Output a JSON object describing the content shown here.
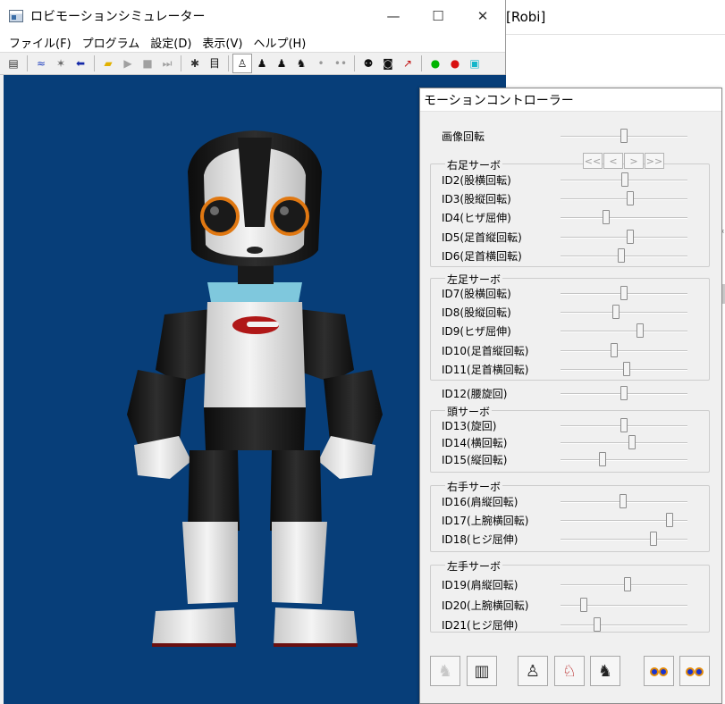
{
  "background_app": {
    "title": "[Robi]",
    "mark": "*"
  },
  "window": {
    "title": "ロビモーションシミュレーター",
    "controls": {
      "minimize": "—",
      "maximize": "☐",
      "close": "✕"
    }
  },
  "menu": [
    "ファイル(F)",
    "プログラム",
    "設定(D)",
    "表示(V)",
    "ヘルプ(H)"
  ],
  "toolbar": {
    "buttons": [
      {
        "icon": "list-icon",
        "glyph": "▤",
        "color": "#333333"
      },
      {
        "icon": "wave-icon",
        "glyph": "≈",
        "color": "#1f3fbf"
      },
      {
        "icon": "dance-icon",
        "glyph": "✶",
        "color": "#666666"
      },
      {
        "icon": "back-arrow-icon",
        "glyph": "⬅",
        "color": "#1428a8"
      },
      {
        "icon": "folder-open-icon",
        "glyph": "▰",
        "color": "#e2b100"
      },
      {
        "icon": "play-icon",
        "glyph": "▶",
        "color": "#a0a0a0"
      },
      {
        "icon": "stop-icon",
        "glyph": "■",
        "color": "#a0a0a0"
      },
      {
        "icon": "step-icon",
        "glyph": "⏭",
        "color": "#a0a0a0"
      },
      {
        "icon": "bug-icon",
        "glyph": "✱",
        "color": "#333333"
      },
      {
        "icon": "frame-icon",
        "glyph": "目",
        "color": "#111111"
      },
      {
        "icon": "robot-front-icon",
        "glyph": "♙",
        "color": "#111111"
      },
      {
        "icon": "robot-arm-up-icon",
        "glyph": "♟",
        "color": "#111111"
      },
      {
        "icon": "robot-stand-icon",
        "glyph": "♟",
        "color": "#111111"
      },
      {
        "icon": "robot-sit-icon",
        "glyph": "♞",
        "color": "#111111"
      },
      {
        "icon": "eye-single-icon",
        "glyph": "•",
        "color": "#999999"
      },
      {
        "icon": "eyes-double-icon",
        "glyph": "••",
        "color": "#999999"
      },
      {
        "icon": "robots-pair-icon",
        "glyph": "⚉",
        "color": "#111111"
      },
      {
        "icon": "camera-icon",
        "glyph": "◙",
        "color": "#111111"
      },
      {
        "icon": "robot-walk-icon",
        "glyph": "↗",
        "color": "#c01010"
      },
      {
        "icon": "green-light-icon",
        "glyph": "●",
        "color": "#00b400"
      },
      {
        "icon": "red-light-icon",
        "glyph": "●",
        "color": "#d81010"
      },
      {
        "icon": "robot-teal-icon",
        "glyph": "▣",
        "color": "#13b6c9"
      }
    ]
  },
  "colors": {
    "viewport_bg": "#073e79",
    "robot_black": "#1a1a1a",
    "robot_white": "#e8e8e8",
    "eye_ring": "#e07812",
    "collar": "#7fc8dd",
    "logo_red": "#b01818"
  },
  "controller": {
    "title": "モーションコントローラー",
    "image_rotation": {
      "label": "画像回転",
      "value": 0.5
    },
    "nav_buttons": [
      "<<",
      "<",
      ">",
      ">>"
    ],
    "right_leg": {
      "title": "右足サーボ",
      "servos": [
        {
          "label": "ID2(股横回転)",
          "value": 0.51
        },
        {
          "label": "ID3(股縦回転)",
          "value": 0.55
        },
        {
          "label": "ID4(ヒザ屈伸)",
          "value": 0.36
        },
        {
          "label": "ID5(足首縦回転)",
          "value": 0.55
        },
        {
          "label": "ID6(足首横回転)",
          "value": 0.48
        }
      ]
    },
    "left_leg": {
      "title": "左足サーボ",
      "servos": [
        {
          "label": "ID7(股横回転)",
          "value": 0.5
        },
        {
          "label": "ID8(股縦回転)",
          "value": 0.44
        },
        {
          "label": "ID9(ヒザ屈伸)",
          "value": 0.63
        },
        {
          "label": "ID10(足首縦回転)",
          "value": 0.42
        },
        {
          "label": "ID11(足首横回転)",
          "value": 0.52
        }
      ]
    },
    "waist": {
      "label": "ID12(腰旋回)",
      "value": 0.5
    },
    "head": {
      "title": "頭サーボ",
      "servos": [
        {
          "label": "ID13(旋回)",
          "value": 0.5
        },
        {
          "label": "ID14(横回転)",
          "value": 0.56
        },
        {
          "label": "ID15(縦回転)",
          "value": 0.33
        }
      ]
    },
    "right_arm": {
      "title": "右手サーボ",
      "servos": [
        {
          "label": "ID16(肩縦回転)",
          "value": 0.49
        },
        {
          "label": "ID17(上腕横回転)",
          "value": 0.86
        },
        {
          "label": "ID18(ヒジ屈伸)",
          "value": 0.73
        }
      ]
    },
    "left_arm": {
      "title": "左手サーボ",
      "servos": [
        {
          "label": "ID19(肩縦回転)",
          "value": 0.53
        },
        {
          "label": "ID20(上腕横回転)",
          "value": 0.18
        },
        {
          "label": "ID21(ヒジ屈伸)",
          "value": 0.29
        }
      ]
    },
    "bottom_buttons": [
      {
        "icon": "robot-head-gray-icon",
        "glyph": "♞",
        "color": "#c8c8c8"
      },
      {
        "icon": "remote-control-icon",
        "glyph": "▥",
        "color": "#333333"
      },
      {
        "icon": "robot-standing-icon",
        "glyph": "♙",
        "color": "#222222"
      },
      {
        "icon": "robot-walking-icon",
        "glyph": "♘",
        "color": "#b01010"
      },
      {
        "icon": "robot-kneeling-icon",
        "glyph": "♞",
        "color": "#222222"
      },
      {
        "icon": "eyes-blue-icon",
        "glyph": "",
        "color": "#1733d1"
      },
      {
        "icon": "eyes-blue-icon-2",
        "glyph": "",
        "color": "#1733d1"
      }
    ]
  }
}
